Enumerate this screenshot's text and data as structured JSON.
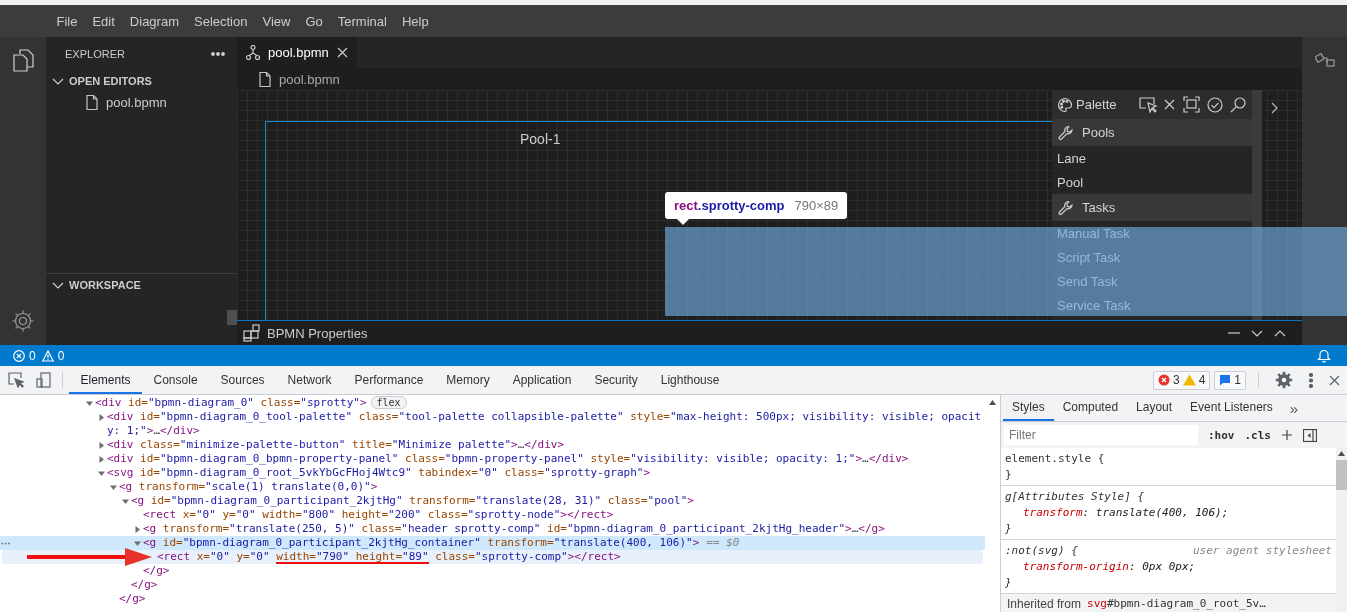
{
  "menu_bar": [
    "File",
    "Edit",
    "Diagram",
    "Selection",
    "View",
    "Go",
    "Terminal",
    "Help"
  ],
  "sidebar": {
    "title": "EXPLORER",
    "sections": [
      {
        "title": "OPEN EDITORS",
        "expanded": true,
        "items": [
          {
            "label": "pool.bpmn"
          }
        ]
      },
      {
        "title": "WORKSPACE",
        "expanded": true
      }
    ]
  },
  "editor_tabs": [
    {
      "label": "pool.bpmn",
      "selected": true
    }
  ],
  "breadcrumb": [
    "pool.bpmn"
  ],
  "diagram": {
    "pool_label": "Pool-1"
  },
  "palette": {
    "title": "Palette",
    "groups": [
      {
        "title": "Pools",
        "items": [
          "Lane",
          "Pool"
        ]
      },
      {
        "title": "Tasks",
        "items": [
          "Manual Task",
          "Script Task",
          "Send Task",
          "Service Task"
        ]
      }
    ]
  },
  "inspect_tooltip": {
    "tag": "rect",
    "class": ".sprotty-comp",
    "size": "790×89"
  },
  "bottom_panel": {
    "title": "BPMN Properties"
  },
  "status_bar": {
    "errors": "0",
    "warnings": "0"
  },
  "devtools": {
    "tabs": [
      {
        "label": "Elements",
        "selected": true
      },
      {
        "label": "Console",
        "selected": false
      },
      {
        "label": "Sources",
        "selected": false
      },
      {
        "label": "Network",
        "selected": false
      },
      {
        "label": "Performance",
        "selected": false
      },
      {
        "label": "Memory",
        "selected": false
      },
      {
        "label": "Application",
        "selected": false
      },
      {
        "label": "Security",
        "selected": false
      },
      {
        "label": "Lighthouse",
        "selected": false
      }
    ],
    "issues": {
      "errors": "3",
      "warnings": "4",
      "messages": "1"
    },
    "dom_tree": [
      {
        "selected": false,
        "hovered": false,
        "expanded": true,
        "badge": "flex",
        "tokens": [
          {
            "kind": "tag",
            "text": "<div"
          },
          {
            "kind": "attr",
            "text": " id="
          },
          {
            "kind": "value",
            "text": "\"bpmn-diagram_0\""
          },
          {
            "kind": "attr",
            "text": " class="
          },
          {
            "kind": "value",
            "text": "\"sprotty\""
          },
          {
            "kind": "tag",
            "text": ">"
          }
        ],
        "children": [
          {
            "selected": false,
            "hovered": false,
            "expanded": false,
            "tokens": [
              {
                "kind": "tag",
                "text": "<div"
              },
              {
                "kind": "attr",
                "text": " id="
              },
              {
                "kind": "value",
                "text": "\"bpmn-diagram_0_tool-palette\""
              },
              {
                "kind": "attr",
                "text": " class="
              },
              {
                "kind": "value",
                "text": "\"tool-palette collapsible-palette\""
              },
              {
                "kind": "attr",
                "text": " style="
              },
              {
                "kind": "value",
                "text": "\"max-height: 500px; visibility: visible; opacity: 1;\""
              },
              {
                "kind": "tag",
                "text": ">"
              },
              {
                "kind": "ellipsis",
                "text": "…"
              },
              {
                "kind": "tag",
                "text": "</div>"
              }
            ]
          },
          {
            "selected": false,
            "hovered": false,
            "expanded": false,
            "tokens": [
              {
                "kind": "tag",
                "text": "<div"
              },
              {
                "kind": "attr",
                "text": " class="
              },
              {
                "kind": "value",
                "text": "\"minimize-palette-button\""
              },
              {
                "kind": "attr",
                "text": " title="
              },
              {
                "kind": "value",
                "text": "\"Minimize palette\""
              },
              {
                "kind": "tag",
                "text": ">"
              },
              {
                "kind": "ellipsis",
                "text": "…"
              },
              {
                "kind": "tag",
                "text": "</div>"
              }
            ]
          },
          {
            "selected": false,
            "hovered": false,
            "expanded": false,
            "tokens": [
              {
                "kind": "tag",
                "text": "<div"
              },
              {
                "kind": "attr",
                "text": " id="
              },
              {
                "kind": "value",
                "text": "\"bpmn-diagram_0_bpmn-property-panel\""
              },
              {
                "kind": "attr",
                "text": " class="
              },
              {
                "kind": "value",
                "text": "\"bpmn-property-panel\""
              },
              {
                "kind": "attr",
                "text": " style="
              },
              {
                "kind": "value",
                "text": "\"visibility: visible; opacity: 1;\""
              },
              {
                "kind": "tag",
                "text": ">"
              },
              {
                "kind": "ellipsis",
                "text": "…"
              },
              {
                "kind": "tag",
                "text": "</div>"
              }
            ]
          },
          {
            "selected": false,
            "hovered": false,
            "expanded": true,
            "tokens": [
              {
                "kind": "tag",
                "text": "<svg"
              },
              {
                "kind": "attr",
                "text": " id="
              },
              {
                "kind": "value",
                "text": "\"bpmn-diagram_0_root_5vkYbGcFHoj4Wtc9\""
              },
              {
                "kind": "attr",
                "text": " tabindex="
              },
              {
                "kind": "value",
                "text": "\"0\""
              },
              {
                "kind": "attr",
                "text": " class="
              },
              {
                "kind": "value",
                "text": "\"sprotty-graph\""
              },
              {
                "kind": "tag",
                "text": ">"
              }
            ],
            "children": [
              {
                "selected": false,
                "hovered": false,
                "expanded": true,
                "tokens": [
                  {
                    "kind": "tag",
                    "text": "<g"
                  },
                  {
                    "kind": "attr",
                    "text": " transform="
                  },
                  {
                    "kind": "value",
                    "text": "\"scale(1) translate(0,0)\""
                  },
                  {
                    "kind": "tag",
                    "text": ">"
                  }
                ],
                "children": [
                  {
                    "selected": false,
                    "hovered": false,
                    "expanded": true,
                    "tokens": [
                      {
                        "kind": "tag",
                        "text": "<g"
                      },
                      {
                        "kind": "attr",
                        "text": " id="
                      },
                      {
                        "kind": "value",
                        "text": "\"bpmn-diagram_0_participant_2kjtHg\""
                      },
                      {
                        "kind": "attr",
                        "text": " transform="
                      },
                      {
                        "kind": "value",
                        "text": "\"translate(28, 31)\""
                      },
                      {
                        "kind": "attr",
                        "text": " class="
                      },
                      {
                        "kind": "value",
                        "text": "\"pool\""
                      },
                      {
                        "kind": "tag",
                        "text": ">"
                      }
                    ],
                    "children": [
                      {
                        "selected": false,
                        "hovered": false,
                        "tokens": [
                          {
                            "kind": "tag",
                            "text": "<rect"
                          },
                          {
                            "kind": "attr",
                            "text": " x="
                          },
                          {
                            "kind": "value",
                            "text": "\"0\""
                          },
                          {
                            "kind": "attr",
                            "text": " y="
                          },
                          {
                            "kind": "value",
                            "text": "\"0\""
                          },
                          {
                            "kind": "attr",
                            "text": " width="
                          },
                          {
                            "kind": "value",
                            "text": "\"800\""
                          },
                          {
                            "kind": "attr",
                            "text": " height="
                          },
                          {
                            "kind": "value",
                            "text": "\"200\""
                          },
                          {
                            "kind": "attr",
                            "text": " class="
                          },
                          {
                            "kind": "value",
                            "text": "\"sprotty-node\""
                          },
                          {
                            "kind": "tag",
                            "text": "></rect>"
                          }
                        ]
                      },
                      {
                        "selected": false,
                        "hovered": false,
                        "expanded": false,
                        "tokens": [
                          {
                            "kind": "tag",
                            "text": "<g"
                          },
                          {
                            "kind": "attr",
                            "text": " transform="
                          },
                          {
                            "kind": "value",
                            "text": "\"translate(250, 5)\""
                          },
                          {
                            "kind": "attr",
                            "text": " class="
                          },
                          {
                            "kind": "value",
                            "text": "\"header sprotty-comp\""
                          },
                          {
                            "kind": "attr",
                            "text": " id="
                          },
                          {
                            "kind": "value",
                            "text": "\"bpmn-diagram_0_participant_2kjtHg_header\""
                          },
                          {
                            "kind": "tag",
                            "text": ">"
                          },
                          {
                            "kind": "ellipsis",
                            "text": "…"
                          },
                          {
                            "kind": "tag",
                            "text": "</g>"
                          }
                        ]
                      },
                      {
                        "selected": true,
                        "hovered": false,
                        "expanded": true,
                        "console_ref": "== $0",
                        "tokens": [
                          {
                            "kind": "tag",
                            "text": "<g"
                          },
                          {
                            "kind": "attr",
                            "text": " id="
                          },
                          {
                            "kind": "value",
                            "text": "\"bpmn-diagram_0_participant_2kjtHg_container\""
                          },
                          {
                            "kind": "attr",
                            "text": " transform="
                          },
                          {
                            "kind": "value",
                            "text": "\"translate(400, 106)\""
                          },
                          {
                            "kind": "tag",
                            "text": ">"
                          }
                        ],
                        "children": [
                          {
                            "selected": false,
                            "hovered": true,
                            "annotated": true,
                            "tokens": [
                              {
                                "kind": "tag",
                                "text": "<rect"
                              },
                              {
                                "kind": "attr",
                                "text": " x="
                              },
                              {
                                "kind": "value",
                                "text": "\"0\""
                              },
                              {
                                "kind": "attr",
                                "text": " y="
                              },
                              {
                                "kind": "value",
                                "text": "\"0\" "
                              },
                              {
                                "kind": "attr",
                                "text": "width=",
                                "underline": true
                              },
                              {
                                "kind": "value",
                                "text": "\"790\"",
                                "underline": true
                              },
                              {
                                "kind": "attr",
                                "text": " height=",
                                "underline": true
                              },
                              {
                                "kind": "value",
                                "text": "\"89\"",
                                "underline": true
                              },
                              {
                                "kind": "attr",
                                "text": " class="
                              },
                              {
                                "kind": "value",
                                "text": "\"sprotty-comp\""
                              },
                              {
                                "kind": "tag",
                                "text": "></rect>"
                              }
                            ]
                          }
                        ]
                      },
                      {
                        "selected": false,
                        "hovered": false,
                        "tokens": [
                          {
                            "kind": "tag",
                            "text": "</g>"
                          }
                        ]
                      }
                    ]
                  },
                  {
                    "selected": false,
                    "hovered": false,
                    "tokens": [
                      {
                        "kind": "tag",
                        "text": "</g>"
                      }
                    ]
                  }
                ]
              },
              {
                "selected": false,
                "hovered": false,
                "tokens": [
                  {
                    "kind": "tag",
                    "text": "</g>"
                  }
                ]
              }
            ]
          }
        ]
      }
    ],
    "styles_pane": {
      "tabs": [
        {
          "label": "Styles",
          "selected": true
        },
        {
          "label": "Computed",
          "selected": false
        },
        {
          "label": "Layout",
          "selected": false
        },
        {
          "label": "Event Listeners",
          "selected": false
        }
      ],
      "overflow": "»",
      "filter_placeholder": "Filter",
      "hov": ":hov",
      "cls": ".cls",
      "rules": [
        {
          "kind": "inline",
          "selector": "element.style {",
          "close": "}"
        },
        {
          "kind": "attributes",
          "selector": "g[Attributes Style] {",
          "declarations": [
            {
              "property": "transform",
              "value": ": translate(400, 106);"
            }
          ],
          "close": "}"
        },
        {
          "kind": "user_agent",
          "selector": ":not(svg) {",
          "origin": "user agent stylesheet",
          "declarations": [
            {
              "property": "transform-origin",
              "value": ": 0px 0px;"
            }
          ],
          "close": "}"
        }
      ],
      "inherited": {
        "label": "Inherited from",
        "tag": "svg",
        "rest": "#bpmn-diagram_0_root_5v…"
      }
    }
  }
}
